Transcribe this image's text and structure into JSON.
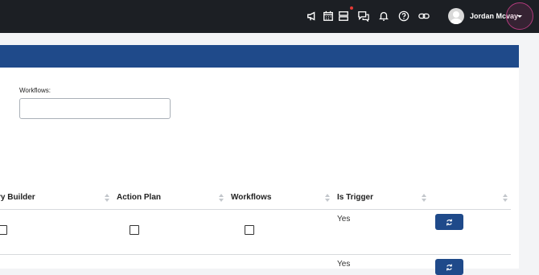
{
  "header": {
    "user_name": "Jordan Mcvay",
    "icons": [
      "megaphone-icon",
      "calendar-icon",
      "stack-icon",
      "chat-icon",
      "bell-icon",
      "help-icon",
      "link-icon",
      "avatar",
      "chevron-down-icon"
    ]
  },
  "filters": {
    "workflows_label": "Workflows:",
    "workflows_value": ""
  },
  "table": {
    "columns": [
      "ry Builder",
      "Action Plan",
      "Workflows",
      "Is Trigger",
      ""
    ],
    "rows": [
      {
        "is_trigger": "Yes",
        "action_icon": "refresh-icon"
      },
      {
        "is_trigger": "Yes",
        "action_icon": "refresh-icon"
      }
    ]
  },
  "colors": {
    "topbar": "#1c1f24",
    "panel_header": "#1f4a8a",
    "accent_button": "#1f4a8a",
    "highlight_ring": "#b03a7b"
  }
}
